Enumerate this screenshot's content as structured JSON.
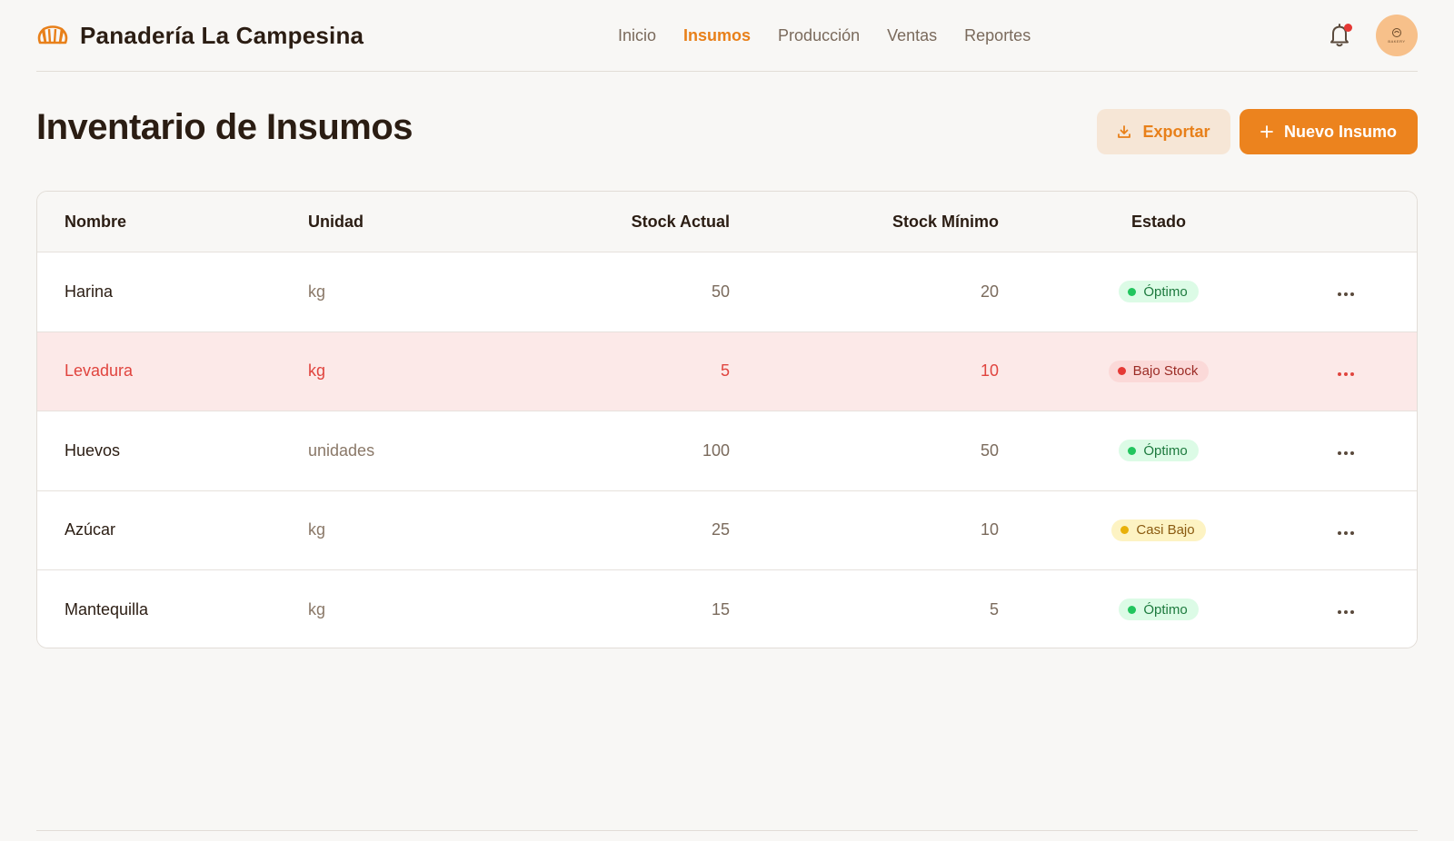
{
  "brand": {
    "title": "Panadería La Campesina",
    "logo_icon": "croissant-icon"
  },
  "nav": {
    "items": [
      {
        "label": "Inicio",
        "active": false
      },
      {
        "label": "Insumos",
        "active": true
      },
      {
        "label": "Producción",
        "active": false
      },
      {
        "label": "Ventas",
        "active": false
      },
      {
        "label": "Reportes",
        "active": false
      }
    ]
  },
  "header": {
    "notification_icon": "bell-icon",
    "has_notifications": true,
    "avatar_text": "BAKERY"
  },
  "page": {
    "title": "Inventario de Insumos"
  },
  "actions": {
    "export_label": "Exportar",
    "new_label": "Nuevo Insumo"
  },
  "table": {
    "columns": [
      "Nombre",
      "Unidad",
      "Stock Actual",
      "Stock Mínimo",
      "Estado"
    ],
    "rows": [
      {
        "name": "Harina",
        "unit": "kg",
        "stock": "50",
        "min": "20",
        "status": "Óptimo",
        "status_type": "ok"
      },
      {
        "name": "Levadura",
        "unit": "kg",
        "stock": "5",
        "min": "10",
        "status": "Bajo Stock",
        "status_type": "low"
      },
      {
        "name": "Huevos",
        "unit": "unidades",
        "stock": "100",
        "min": "50",
        "status": "Óptimo",
        "status_type": "ok"
      },
      {
        "name": "Azúcar",
        "unit": "kg",
        "stock": "25",
        "min": "10",
        "status": "Casi Bajo",
        "status_type": "warn"
      },
      {
        "name": "Mantequilla",
        "unit": "kg",
        "stock": "15",
        "min": "5",
        "status": "Óptimo",
        "status_type": "ok"
      }
    ]
  },
  "colors": {
    "accent": "#e8801a",
    "background": "#f8f7f5",
    "danger": "#e0443e",
    "success": "#22c55e",
    "warning": "#e8b00a"
  }
}
